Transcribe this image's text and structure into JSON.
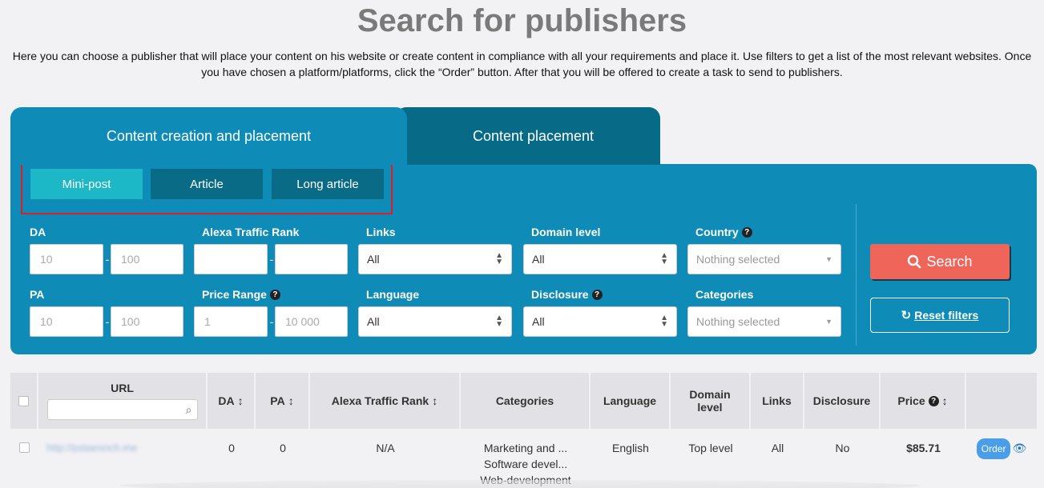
{
  "page": {
    "title": "Search for publishers",
    "intro": "Here you can choose a publisher that will place your content on his website or create content in compliance with all your requirements and place it. Use filters to get a list of the most relevant websites. Once you have chosen a platform/platforms, click the “Order” button. After that you will be offered to create a task to send to publishers."
  },
  "tabs": [
    {
      "label": "Content creation and placement",
      "active": true
    },
    {
      "label": "Content placement",
      "active": false
    }
  ],
  "content_types": [
    {
      "label": "Mini-post",
      "active": true
    },
    {
      "label": "Article",
      "active": false
    },
    {
      "label": "Long article",
      "active": false
    }
  ],
  "filters": {
    "da": {
      "label": "DA",
      "min_placeholder": "10",
      "max_placeholder": "100"
    },
    "pa": {
      "label": "PA",
      "min_placeholder": "10",
      "max_placeholder": "100"
    },
    "alexa": {
      "label": "Alexa Traffic Rank",
      "min_placeholder": "",
      "max_placeholder": ""
    },
    "price": {
      "label": "Price Range",
      "min_placeholder": "1",
      "max_placeholder": "10 000"
    },
    "links": {
      "label": "Links",
      "value": "All"
    },
    "language": {
      "label": "Language",
      "value": "All"
    },
    "domain_level": {
      "label": "Domain level",
      "value": "All"
    },
    "disclosure": {
      "label": "Disclosure",
      "value": "All"
    },
    "country": {
      "label": "Country",
      "value": "Nothing selected"
    },
    "categories": {
      "label": "Categories",
      "value": "Nothing selected"
    }
  },
  "actions": {
    "search_label": "Search",
    "reset_label": "Reset filters"
  },
  "table": {
    "headers": {
      "url": "URL",
      "da": "DA",
      "pa": "PA",
      "alexa": "Alexa Traffic Rank",
      "categories": "Categories",
      "language": "Language",
      "domain_level": "Domain level",
      "links": "Links",
      "disclosure": "Disclosure",
      "price": "Price"
    },
    "rows": [
      {
        "url": "http://pstaesnch.me",
        "da": "0",
        "pa": "0",
        "alexa": "N/A",
        "categories": [
          "Marketing and ...",
          "Software devel...",
          "Web-development"
        ],
        "language": "English",
        "domain_level": "Top level",
        "links": "All",
        "disclosure": "No",
        "price": "$85.71",
        "order_label": "Order"
      }
    ]
  },
  "icons": {
    "help": "question-circle-icon",
    "search": "magnifier-icon",
    "reset": "refresh-icon",
    "sort": "sort-arrows-icon",
    "view": "eye-icon"
  },
  "colors": {
    "panel": "#0e8bb6",
    "tab_inactive": "#076b87",
    "type_active": "#1cb8c7",
    "type_inactive": "#0a6b87",
    "search_button": "#f0655a",
    "highlight_border": "#d9202a"
  }
}
